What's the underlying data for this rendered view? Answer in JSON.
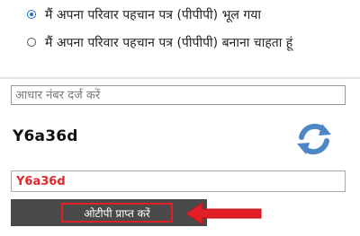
{
  "options": [
    {
      "label": "मैं अपना परिवार पहचान पत्र (पीपीपी) भूल गया",
      "checked": true
    },
    {
      "label": "मैं अपना परिवार पहचान पत्र (पीपीपी) बनाना चाहता हूं",
      "checked": false
    }
  ],
  "aadhaar": {
    "placeholder": "आधार नंबर दर्ज करें",
    "value": ""
  },
  "captcha": {
    "code": "Y6a36d",
    "entered": "Y6a36d"
  },
  "otp_button": {
    "label": "ओटीपी प्राप्त करें"
  },
  "icons": {
    "refresh": "refresh-icon",
    "arrow": "red-arrow-icon"
  },
  "colors": {
    "accent": "#1e6fd0",
    "highlight": "#e21f26",
    "button_bg": "#4a4a4a",
    "refresh": "#4f86c6"
  }
}
